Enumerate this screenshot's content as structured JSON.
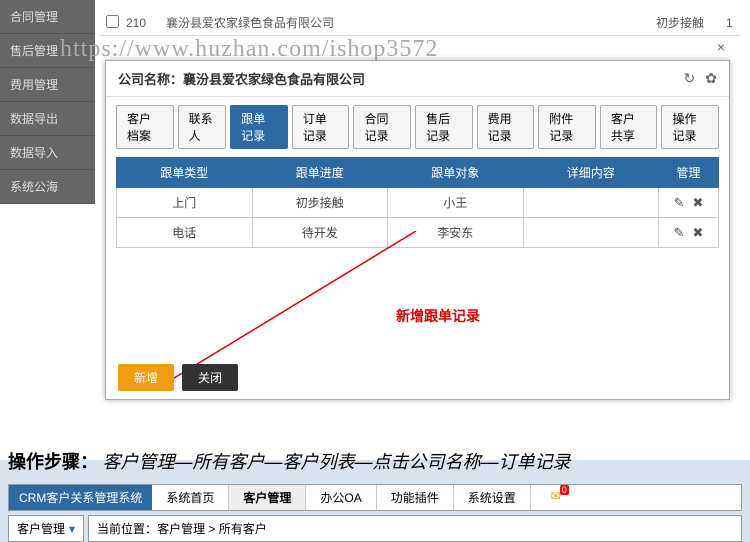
{
  "watermark": "https://www.huzhan.com/ishop3572",
  "sidebar": {
    "items": [
      {
        "label": "合同管理"
      },
      {
        "label": "售后管理"
      },
      {
        "label": "费用管理"
      },
      {
        "label": "数据导出"
      },
      {
        "label": "数据导入"
      },
      {
        "label": "系统公海"
      }
    ]
  },
  "bg_row": {
    "id": "210",
    "company": "襄汾县爱农家绿色食品有限公司",
    "status": "初步接触",
    "num": "1"
  },
  "modal": {
    "title_prefix": "公司名称：",
    "title_company": "襄汾县爱农家绿色食品有限公司",
    "close": "×",
    "tabs": [
      "客户档案",
      "联系人",
      "跟单记录",
      "订单记录",
      "合同记录",
      "售后记录",
      "费用记录",
      "附件记录",
      "客户共享",
      "操作记录"
    ],
    "active_tab": 2,
    "columns": [
      "跟单类型",
      "跟单进度",
      "跟单对象",
      "详细内容",
      "管理"
    ],
    "rows": [
      {
        "type": "上门",
        "progress": "初步接触",
        "target": "小王",
        "detail": ""
      },
      {
        "type": "电话",
        "progress": "待开发",
        "target": "李安东",
        "detail": ""
      }
    ],
    "annotation": "新增跟单记录",
    "btn_add": "新增",
    "btn_close": "关闭"
  },
  "instruction": {
    "label": "操作步骤：",
    "text": "客户管理—所有客户—客户列表—点击公司名称—订单记录"
  },
  "nav": {
    "brand": "CRM客户关系管理系统",
    "items": [
      "系统首页",
      "客户管理",
      "办公OA",
      "功能插件",
      "系统设置"
    ],
    "active": 1,
    "badge": "0"
  },
  "breadcrumb": {
    "left": "客户管理",
    "label": "当前位置：",
    "path": "客户管理 > 所有客户"
  }
}
